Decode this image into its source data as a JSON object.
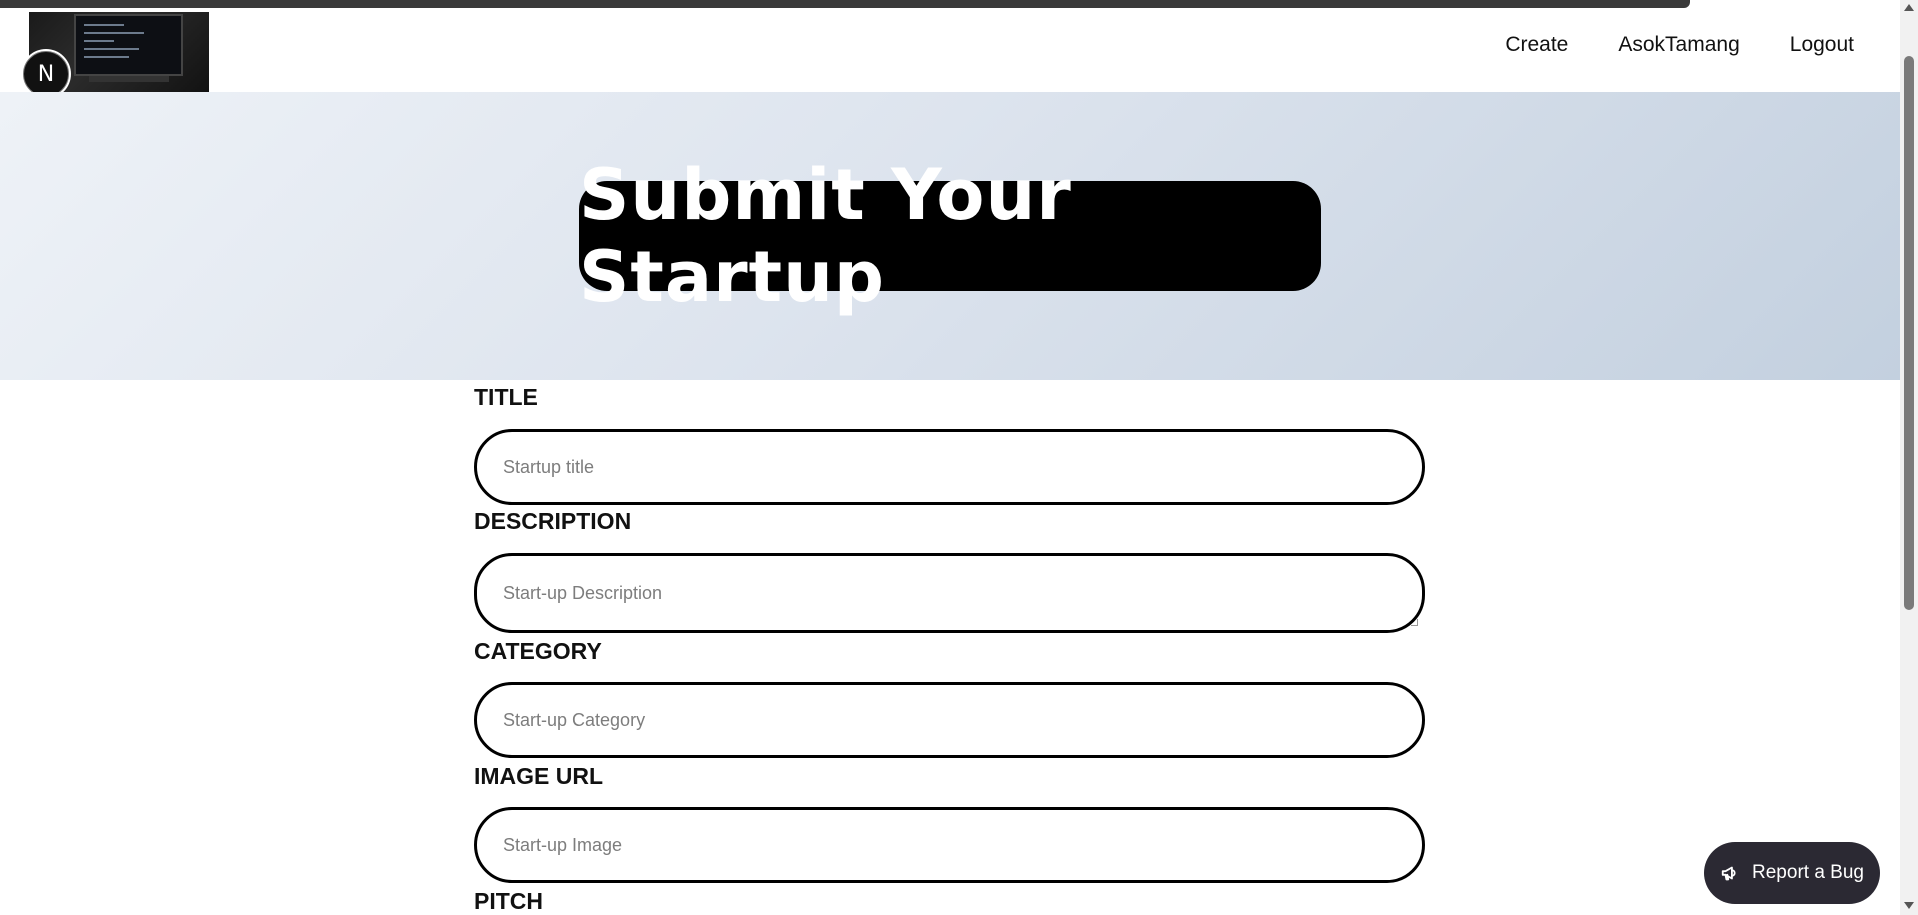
{
  "nav": {
    "logo_badge": "N",
    "links": [
      "Create",
      "AsokTamang",
      "Logout"
    ]
  },
  "hero": {
    "title": "Submit Your Startup"
  },
  "form": {
    "fields": [
      {
        "label": "TITLE",
        "placeholder": "Startup title"
      },
      {
        "label": "DESCRIPTION",
        "placeholder": "Start-up Description"
      },
      {
        "label": "CATEGORY",
        "placeholder": "Start-up Category"
      },
      {
        "label": "IMAGE URL",
        "placeholder": "Start-up Image"
      },
      {
        "label": "PITCH"
      }
    ]
  },
  "report_bug": {
    "label": "Report a Bug",
    "icon": "megaphone-icon"
  }
}
